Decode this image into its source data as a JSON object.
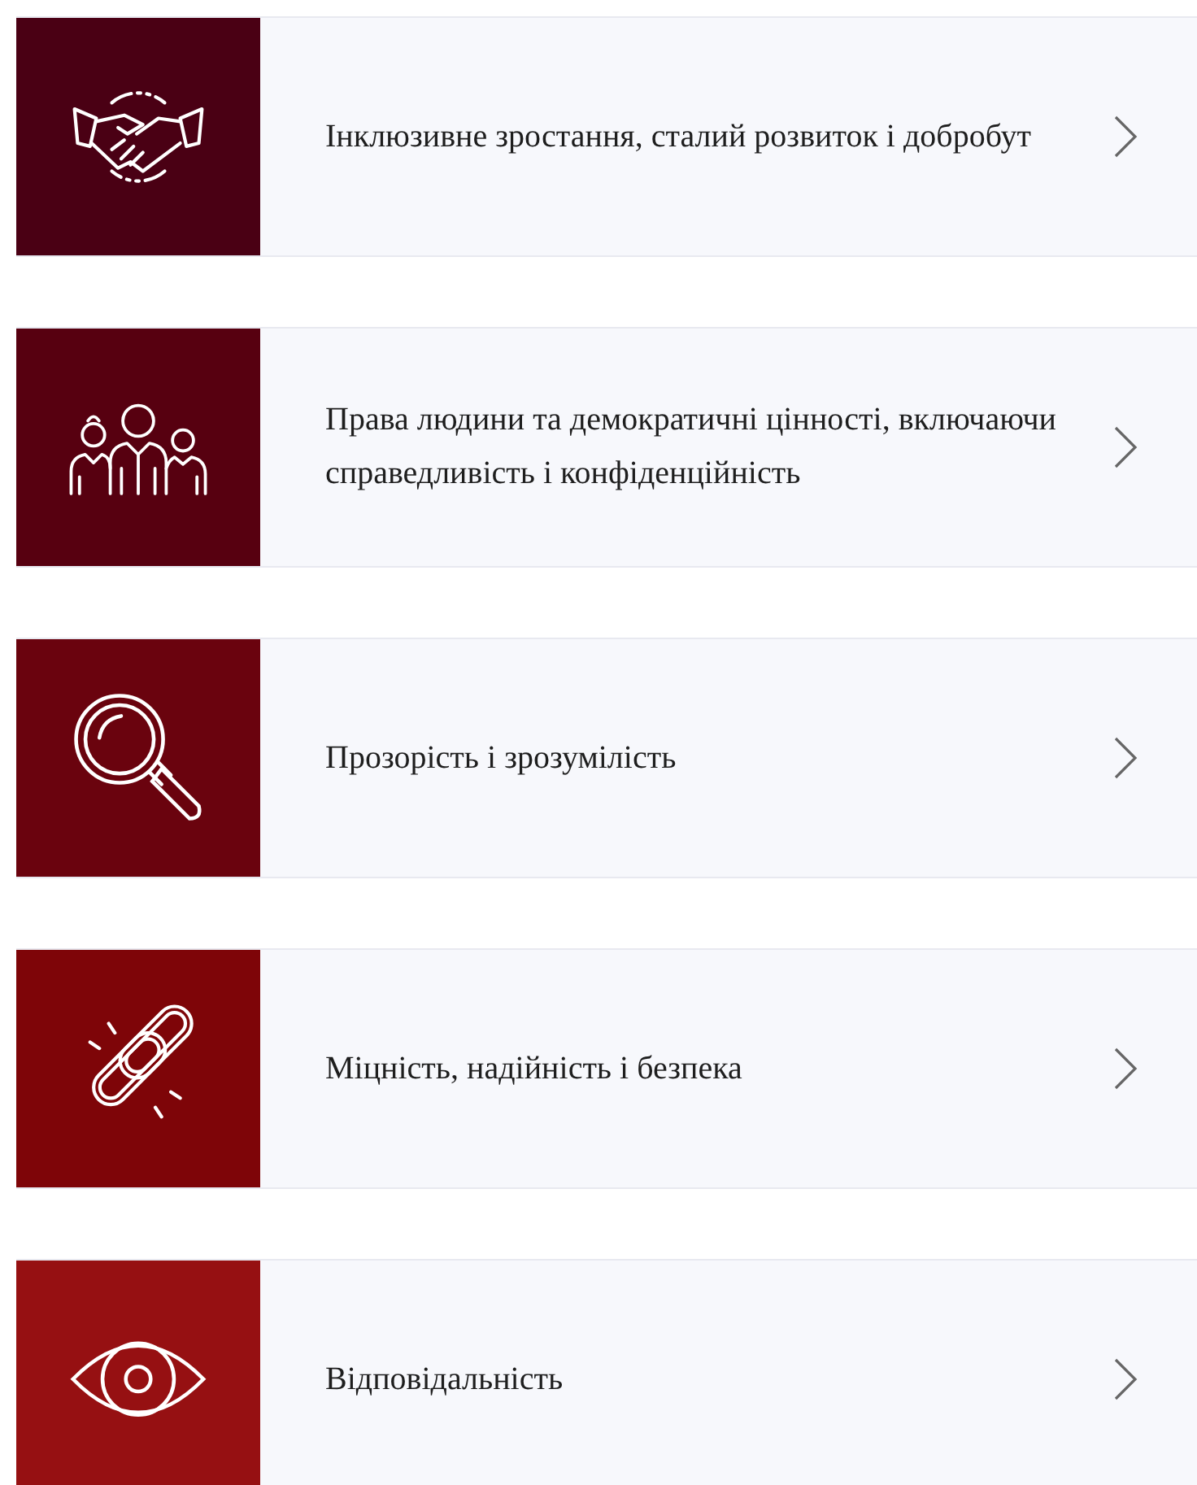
{
  "items": [
    {
      "kind": "handshake",
      "color": "#4a0014",
      "label": "Інклюзивне зростання, сталий розвиток і добробут"
    },
    {
      "kind": "people",
      "color": "#570010",
      "label": "Права людини та демократичні цінності, включаючи справедливість і конфіденційність"
    },
    {
      "kind": "magnifier",
      "color": "#6a030e",
      "label": "Прозорість і зрозумілість"
    },
    {
      "kind": "chain",
      "color": "#7e0508",
      "label": "Міцність, надійність і безпека"
    },
    {
      "kind": "eye",
      "color": "#961012",
      "label": "Відповідальність"
    }
  ]
}
